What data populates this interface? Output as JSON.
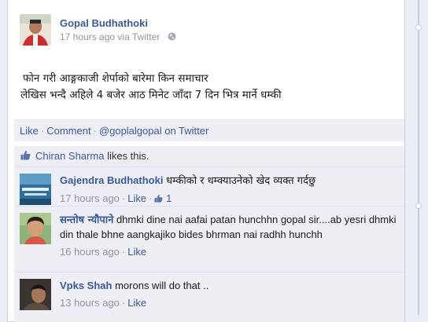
{
  "post": {
    "author": "Gopal Budhathoki",
    "time": "17 hours ago",
    "via": "via Twitter",
    "text_line1": "फोन गरी आङ्गकाजी शेर्पाको बारेमा किन समाचार",
    "text_line2": "लेखिस भन्दै अहिले 4 बजेर आठ मिनेट जाँदा 7 दिन भित्र मार्ने धम्की"
  },
  "actions": {
    "like": "Like",
    "comment": "Comment",
    "twitter": "@goplalgopal on Twitter"
  },
  "likes": {
    "liker": "Chiran Sharma",
    "suffix": "likes this."
  },
  "comments": [
    {
      "name": "Gajendra Budhathoki",
      "text": "धम्कीको र धम्क्याउनेको खेद व्यक्त गर्दछु",
      "time": "17 hours ago",
      "like": "Like",
      "like_count": "1"
    },
    {
      "name": "सन्तोष न्यौपाने",
      "text": "dhmki dine nai aafai patan hunchhn gopal sir....ab yesri dhmki din thale bhne aangkajiko bides bhrman nai radhh hunchh",
      "time": "16 hours ago",
      "like": "Like"
    },
    {
      "name": "Vpks Shah",
      "text": "morons will do that ..",
      "time": "13 hours ago",
      "like": "Like"
    }
  ],
  "colors": {
    "link": "#3b5998",
    "meta": "#90949c",
    "comment_bg": "#edeff4"
  }
}
